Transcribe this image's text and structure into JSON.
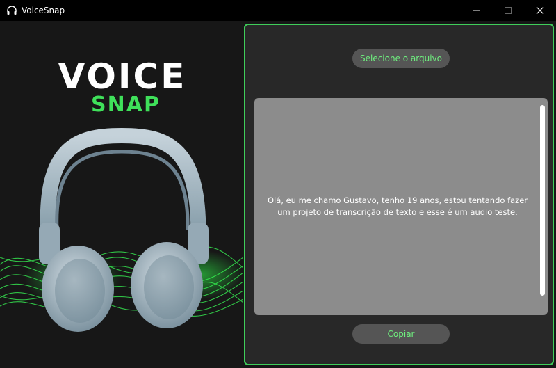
{
  "window": {
    "title": "VoiceSnap",
    "minimize_icon": "minimize-icon",
    "maximize_icon": "maximize-icon",
    "close_icon": "close-icon"
  },
  "brand": {
    "line1": "VOICE",
    "line2": "SNAP",
    "accent_color": "#3fe05a",
    "icon": "headphones-icon"
  },
  "actions": {
    "select_file_label": "Selecione o arquivo",
    "copy_label": "Copiar"
  },
  "transcript": {
    "text": "Olá, eu me chamo Gustavo, tenho 19 anos, estou tentando fazer um projeto de transcrição de texto e esse é um audio teste."
  },
  "colors": {
    "accent": "#3fce5a",
    "button_text": "#6ff07f",
    "panel_bg": "#282828",
    "textbox_bg": "#8c8c8c"
  }
}
